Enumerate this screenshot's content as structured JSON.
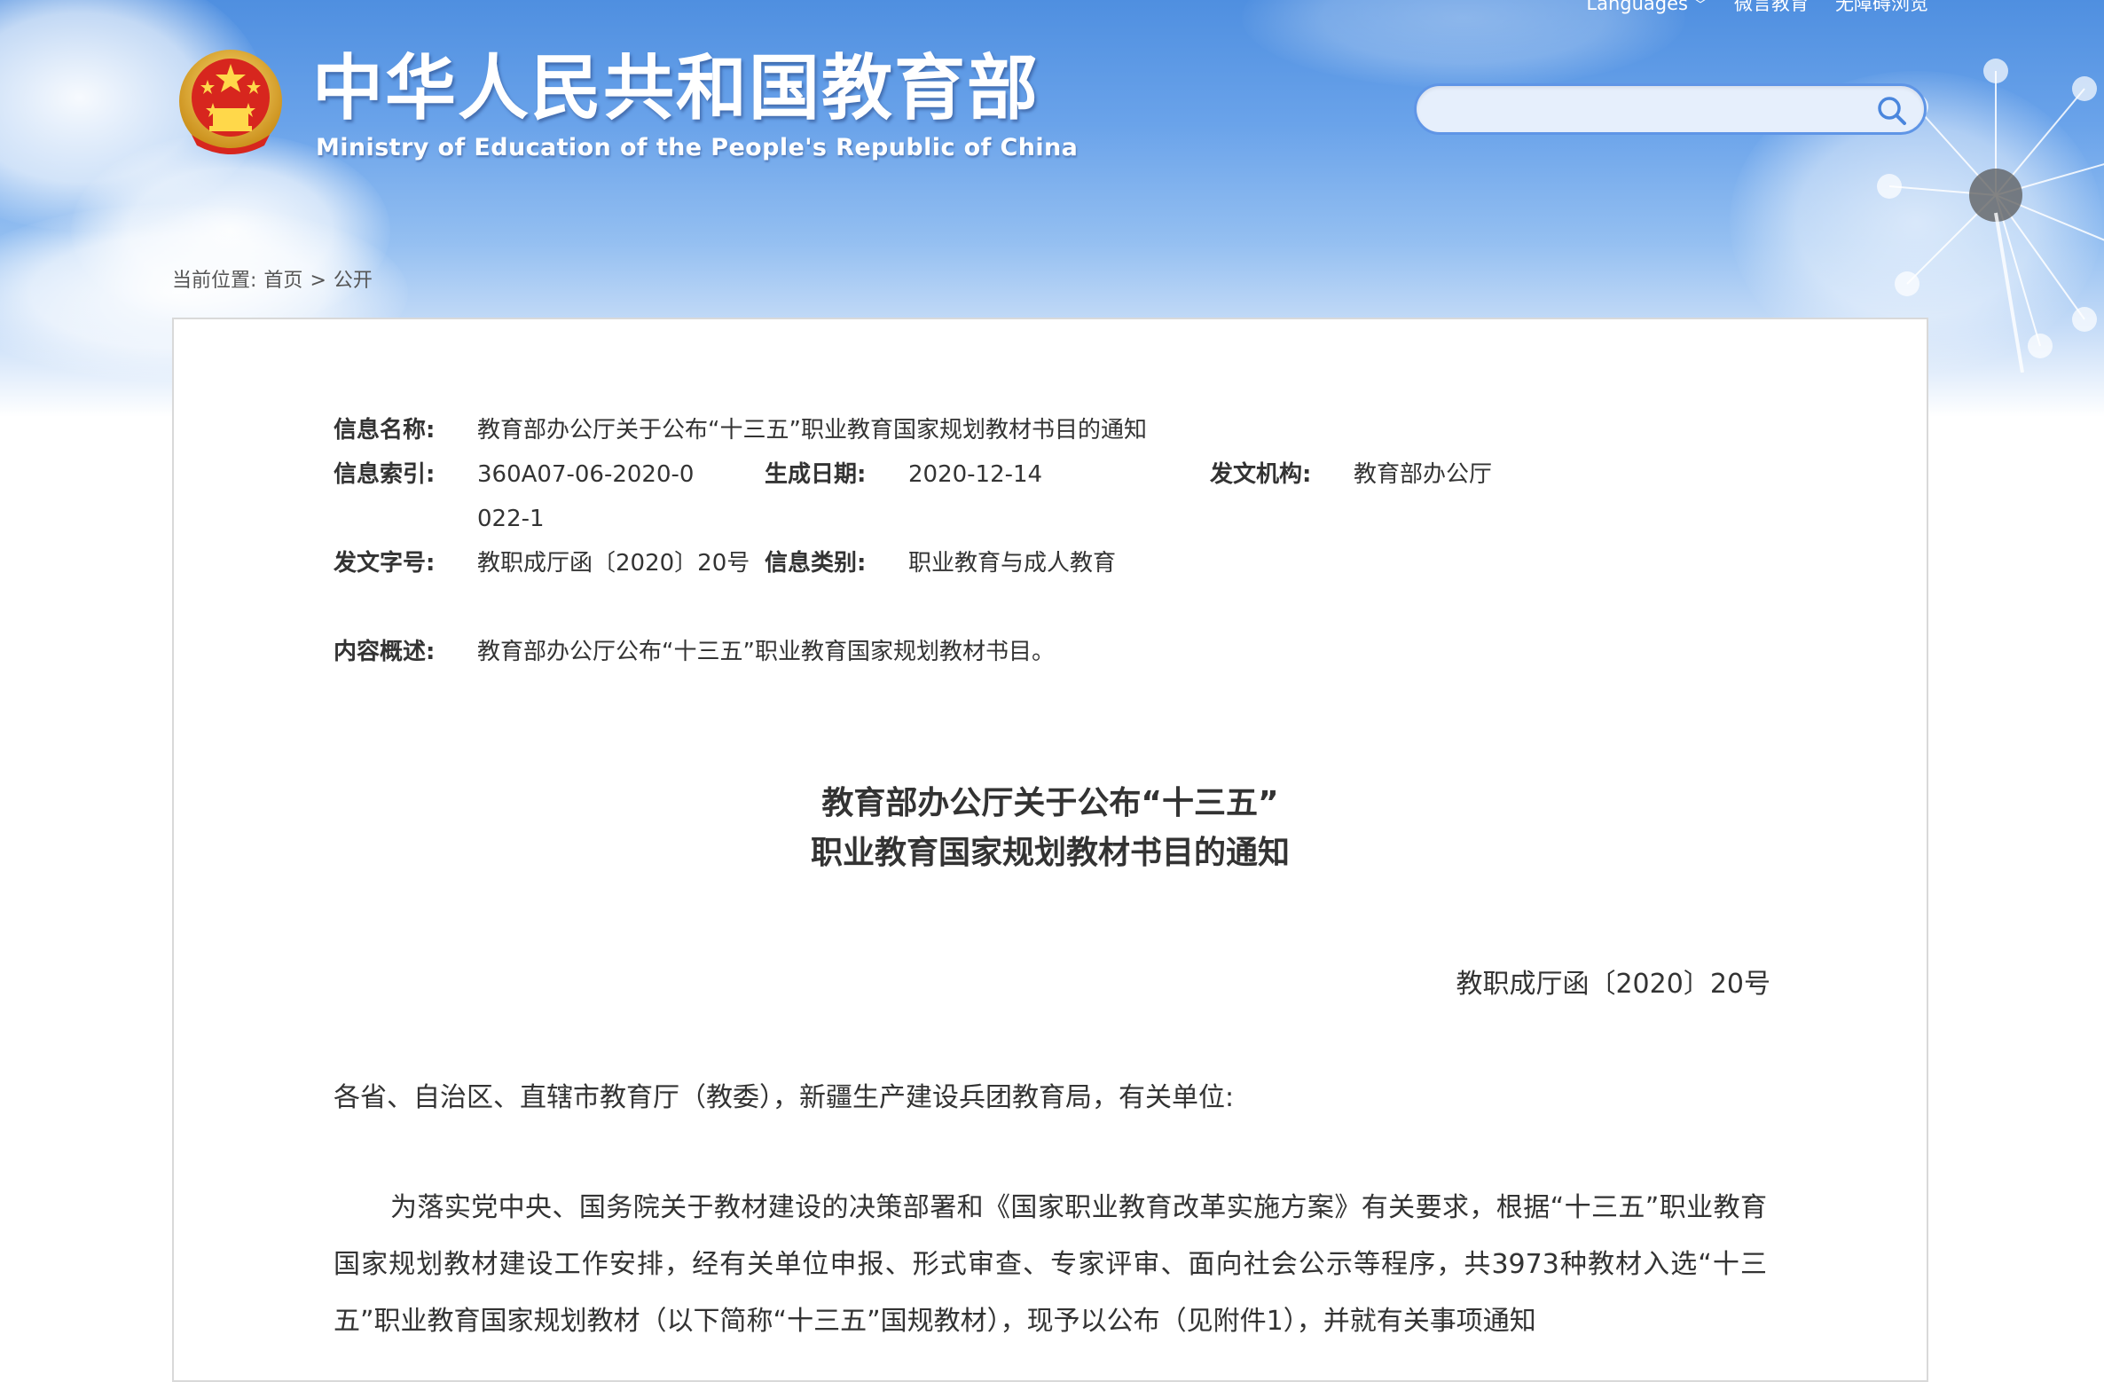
{
  "top_links": {
    "languages": "Languages",
    "weiyan": "微言教育",
    "accessibility": "无障碍浏览"
  },
  "header": {
    "title": "中华人民共和国教育部",
    "subtitle": "Ministry of Education of the People's Republic of China"
  },
  "search": {
    "placeholder": ""
  },
  "breadcrumb": {
    "prefix": "当前位置:",
    "home": "首页",
    "separator": ">",
    "current": "公开"
  },
  "meta": {
    "name_label": "信息名称:",
    "name_value": "教育部办公厅关于公布“十三五”职业教育国家规划教材书目的通知",
    "index_label": "信息索引:",
    "index_value": "360A07-06-2020-0022-1",
    "date_label": "生成日期:",
    "date_value": "2020-12-14",
    "org_label": "发文机构:",
    "org_value": "教育部办公厅",
    "docno_label": "发文字号:",
    "docno_value": "教职成厅函〔2020〕20号",
    "category_label": "信息类别:",
    "category_value": "职业教育与成人教育",
    "summary_label": "内容概述:",
    "summary_value": "教育部办公厅公布“十三五”职业教育国家规划教材书目。"
  },
  "document": {
    "title_line1": "教育部办公厅关于公布“十三五”",
    "title_line2": "职业教育国家规划教材书目的通知",
    "doc_number": "教职成厅函〔2020〕20号",
    "recipient": "各省、自治区、直辖市教育厅（教委），新疆生产建设兵团教育局，有关单位:",
    "body": "为落实党中央、国务院关于教材建设的决策部署和《国家职业教育改革实施方案》有关要求，根据“十三五”职业教育国家规划教材建设工作安排，经有关单位申报、形式审查、专家评审、面向社会公示等程序，共3973种教材入选“十三五”职业教育国家规划教材（以下简称“十三五”国规教材），现予以公布（见附件1），并就有关事项通知"
  },
  "colors": {
    "header_blue": "#4f8fe0",
    "search_border": "#5f95e6",
    "text": "#333333",
    "panel_border": "#d9d9d9"
  }
}
